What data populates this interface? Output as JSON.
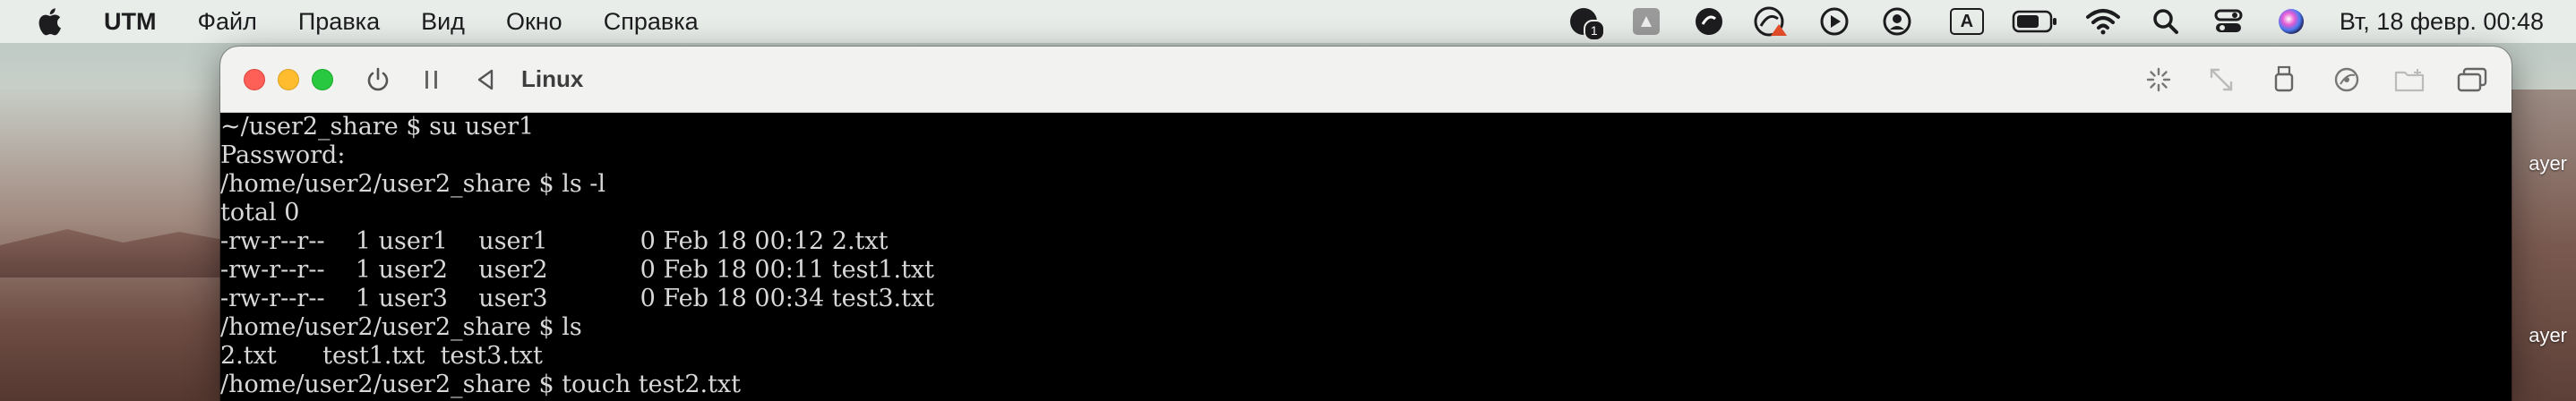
{
  "menubar": {
    "app_name": "UTM",
    "items": [
      "Файл",
      "Правка",
      "Вид",
      "Окно",
      "Справка"
    ],
    "status_icons": [
      {
        "name": "notification-count-icon",
        "badge": "1"
      },
      {
        "name": "google-drive-icon"
      },
      {
        "name": "creative-cloud-icon"
      },
      {
        "name": "creative-cloud-warning-icon"
      },
      {
        "name": "play-circle-icon"
      },
      {
        "name": "user-circle-icon"
      },
      {
        "name": "input-source-a-icon",
        "label": "A"
      },
      {
        "name": "battery-icon"
      },
      {
        "name": "wifi-icon"
      },
      {
        "name": "spotlight-search-icon"
      },
      {
        "name": "control-center-icon"
      },
      {
        "name": "siri-icon"
      }
    ],
    "clock": "Вт, 18 февр.  00:48"
  },
  "wallpaper": {
    "right_labels": [
      "ayer",
      "ayer"
    ]
  },
  "window": {
    "title": "Linux",
    "toolbar_left": [
      "power-icon",
      "pause-icon",
      "back-icon"
    ],
    "toolbar_right": [
      "capture-cursor-icon",
      "resize-icon",
      "usb-icon",
      "drives-icon",
      "shared-folder-icon",
      "windows-icon"
    ]
  },
  "terminal": {
    "lines": [
      "~/user2_share $ su user1",
      "Password:",
      "/home/user2/user2_share $ ls -l",
      "total 0",
      "-rw-r--r--    1 user1    user1            0 Feb 18 00:12 2.txt",
      "-rw-r--r--    1 user2    user2            0 Feb 18 00:11 test1.txt",
      "-rw-r--r--    1 user3    user3            0 Feb 18 00:34 test3.txt",
      "/home/user2/user2_share $ ls",
      "2.txt      test1.txt  test3.txt",
      "/home/user2/user2_share $ touch test2.txt"
    ]
  },
  "colors": {
    "close": "#fe5f57",
    "minimize": "#febc2e",
    "maximize": "#28c840",
    "terminal_bg": "#000000",
    "terminal_fg": "#d8d8d8"
  }
}
